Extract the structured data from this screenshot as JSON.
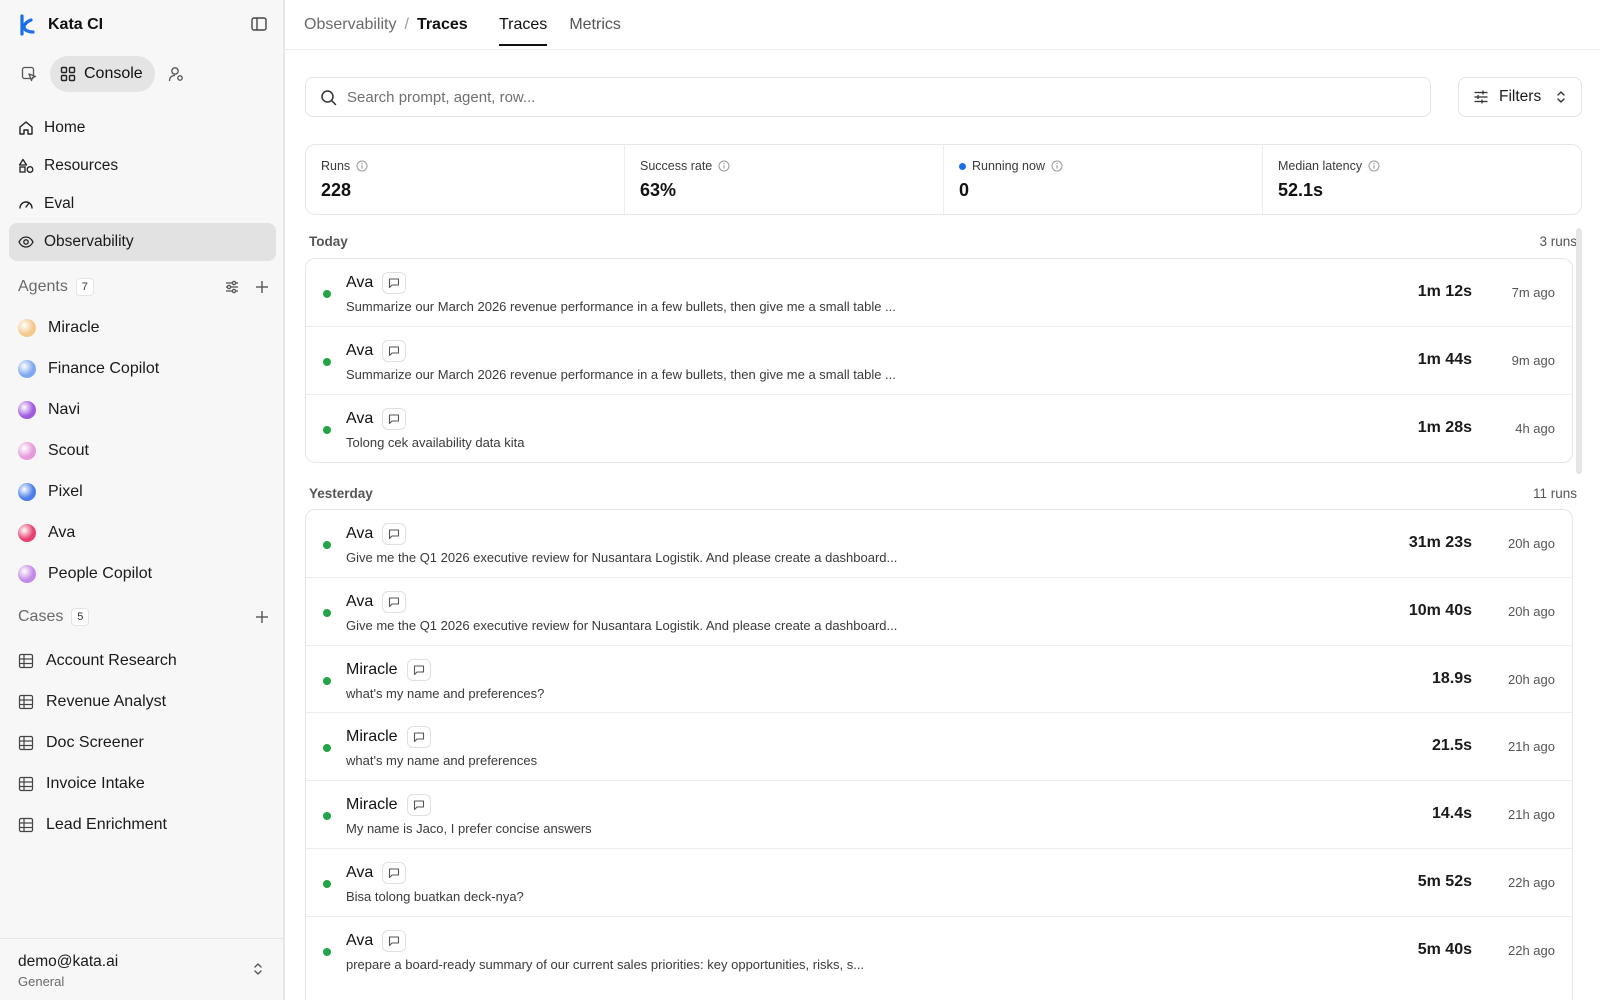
{
  "app": {
    "name": "Kata CI"
  },
  "mode": {
    "console_label": "Console"
  },
  "nav": [
    {
      "label": "Home",
      "icon": "home-icon"
    },
    {
      "label": "Resources",
      "icon": "shapes-icon"
    },
    {
      "label": "Eval",
      "icon": "gauge-icon"
    },
    {
      "label": "Observability",
      "icon": "eye-icon",
      "active": true
    }
  ],
  "agents": {
    "title": "Agents",
    "count": "7",
    "items": [
      {
        "name": "Miracle",
        "color": "#f3c98b"
      },
      {
        "name": "Finance Copilot",
        "color": "#7fa8f0"
      },
      {
        "name": "Navi",
        "color": "#a25be0"
      },
      {
        "name": "Scout",
        "color": "#e59ad9"
      },
      {
        "name": "Pixel",
        "color": "#4d7fe8"
      },
      {
        "name": "Ava",
        "color": "#e8406f"
      },
      {
        "name": "People Copilot",
        "color": "#c48ae8"
      }
    ]
  },
  "cases": {
    "title": "Cases",
    "count": "5",
    "items": [
      {
        "name": "Account Research"
      },
      {
        "name": "Revenue Analyst"
      },
      {
        "name": "Doc Screener"
      },
      {
        "name": "Invoice Intake"
      },
      {
        "name": "Lead Enrichment"
      }
    ]
  },
  "account": {
    "email": "demo@kata.ai",
    "workspace": "General"
  },
  "breadcrumb": {
    "parent": "Observability",
    "separator": "/",
    "current": "Traces"
  },
  "tabs": [
    {
      "label": "Traces",
      "active": true
    },
    {
      "label": "Metrics",
      "active": false
    }
  ],
  "search": {
    "placeholder": "Search prompt, agent, row...",
    "value": ""
  },
  "filters": {
    "label": "Filters"
  },
  "stats": [
    {
      "label": "Runs",
      "value": "228"
    },
    {
      "label": "Success rate",
      "value": "63%"
    },
    {
      "label": "Running now",
      "value": "0",
      "live": true
    },
    {
      "label": "Median latency",
      "value": "52.1s"
    }
  ],
  "groups": [
    {
      "title": "Today",
      "count_label": "3 runs",
      "runs": [
        {
          "agent": "Ava",
          "prompt": "Summarize our March 2026 revenue performance in a few bullets, then give me a small table ...",
          "duration": "1m 12s",
          "ago": "7m ago",
          "status_color": "#22a447"
        },
        {
          "agent": "Ava",
          "prompt": "Summarize our March 2026 revenue performance in a few bullets, then give me a small table ...",
          "duration": "1m 44s",
          "ago": "9m ago",
          "status_color": "#22a447"
        },
        {
          "agent": "Ava",
          "prompt": "Tolong cek availability data kita",
          "duration": "1m 28s",
          "ago": "4h ago",
          "status_color": "#22a447"
        }
      ]
    },
    {
      "title": "Yesterday",
      "count_label": "11 runs",
      "runs": [
        {
          "agent": "Ava",
          "prompt": "Give me the Q1 2026 executive review for Nusantara Logistik. And please create a dashboard...",
          "duration": "31m 23s",
          "ago": "20h ago",
          "status_color": "#22a447"
        },
        {
          "agent": "Ava",
          "prompt": "Give me the Q1 2026 executive review for Nusantara Logistik. And please create a dashboard...",
          "duration": "10m 40s",
          "ago": "20h ago",
          "status_color": "#22a447"
        },
        {
          "agent": "Miracle",
          "prompt": "what's my name and preferences?",
          "duration": "18.9s",
          "ago": "20h ago",
          "status_color": "#22a447"
        },
        {
          "agent": "Miracle",
          "prompt": "what's my name and preferences",
          "duration": "21.5s",
          "ago": "21h ago",
          "status_color": "#22a447"
        },
        {
          "agent": "Miracle",
          "prompt": "My name is Jaco, I prefer concise answers",
          "duration": "14.4s",
          "ago": "21h ago",
          "status_color": "#22a447"
        },
        {
          "agent": "Ava",
          "prompt": "Bisa tolong buatkan deck-nya?",
          "duration": "5m 52s",
          "ago": "22h ago",
          "status_color": "#22a447"
        },
        {
          "agent": "Ava",
          "prompt": "prepare a board-ready summary of our current sales priorities: key opportunities, risks, s...",
          "duration": "5m 40s",
          "ago": "22h ago",
          "status_color": "#22a447"
        }
      ]
    }
  ]
}
